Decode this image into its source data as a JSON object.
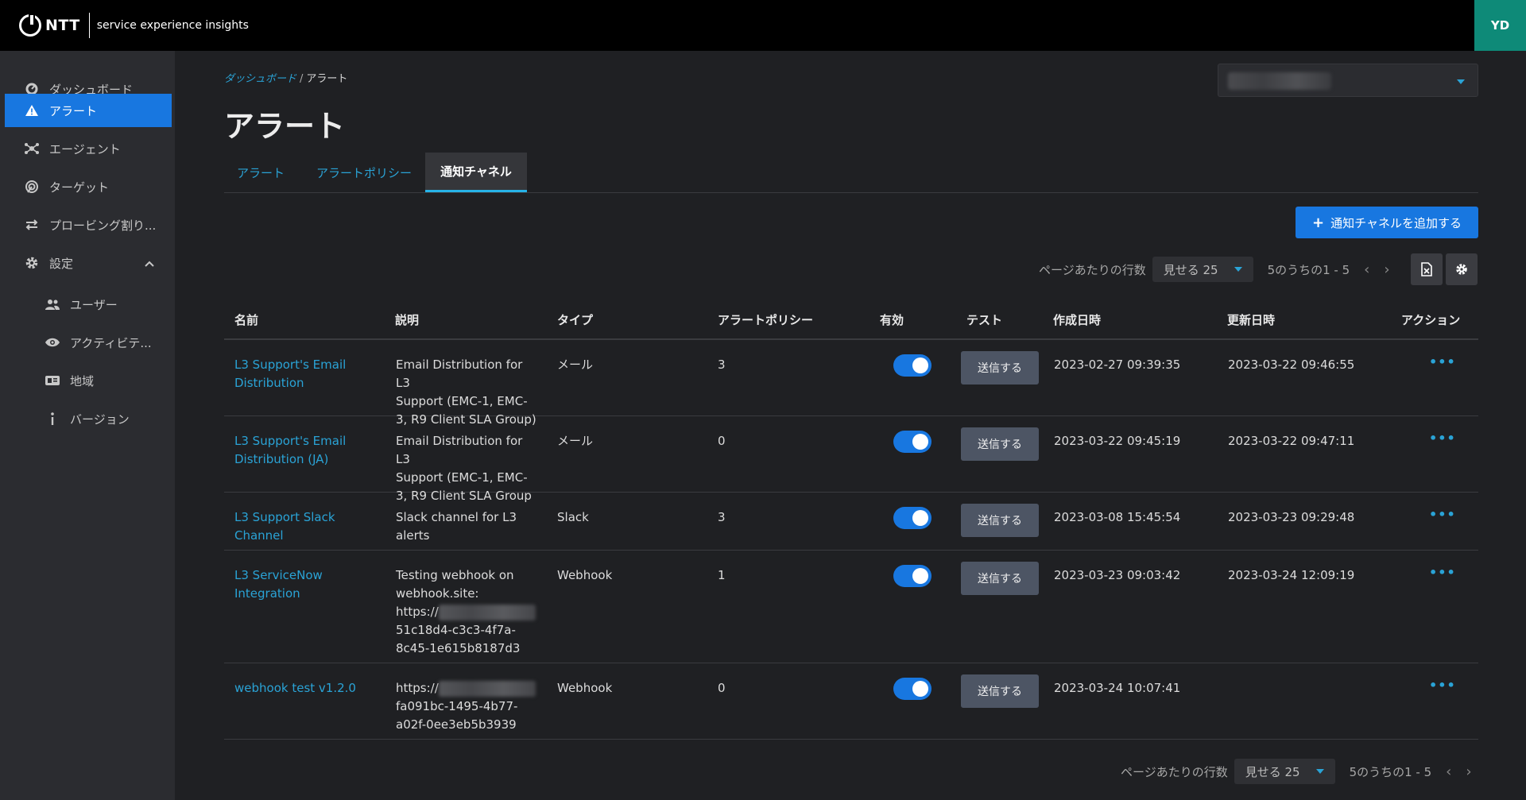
{
  "app": {
    "brand": "NTT",
    "subtitle": "service experience insights",
    "user_initials": "YD"
  },
  "sidebar": {
    "items": [
      {
        "label": "ダッシュボード",
        "icon": "dashboard-icon"
      },
      {
        "label": "アラート",
        "icon": "warning-icon",
        "active": true
      },
      {
        "label": "エージェント",
        "icon": "agent-icon"
      },
      {
        "label": "ターゲット",
        "icon": "target-icon"
      },
      {
        "label": "プロービング割り...",
        "icon": "swap-icon"
      },
      {
        "label": "設定",
        "icon": "gear-icon",
        "expanded": true
      }
    ],
    "sub_items": [
      {
        "label": "ユーザー",
        "icon": "users-icon"
      },
      {
        "label": "アクティビテ...",
        "icon": "eye-icon"
      },
      {
        "label": "地域",
        "icon": "region-card-icon"
      },
      {
        "label": "バージョン",
        "icon": "info-icon"
      }
    ]
  },
  "breadcrumb": {
    "parent": "ダッシュボード",
    "separator": "/",
    "current": "アラート"
  },
  "page_title": "アラート",
  "tabs": [
    {
      "label": "アラート"
    },
    {
      "label": "アラートポリシー"
    },
    {
      "label": "通知チャネル",
      "active": true
    }
  ],
  "add_button": {
    "label": "通知チャネルを追加する"
  },
  "pagination": {
    "rows_label": "ページあたりの行数",
    "rows_value": "見せる 25",
    "range": "5のうちの1 - 5"
  },
  "table": {
    "headers": [
      "名前",
      "説明",
      "タイプ",
      "アラートポリシー",
      "有効",
      "テスト",
      "作成日時",
      "更新日時",
      "アクション"
    ],
    "rows": [
      {
        "name": [
          "L3 Support's Email",
          "Distribution"
        ],
        "desc": [
          "Email Distribution for L3",
          "Support (EMC-1, EMC-",
          "3, R9 Client SLA Group)"
        ],
        "type": "メール",
        "policies": "3",
        "enabled": true,
        "test": "送信する",
        "created": "2023-02-27 09:39:35",
        "updated": "2023-03-22 09:46:55"
      },
      {
        "name": [
          "L3 Support's Email",
          "Distribution (JA)"
        ],
        "desc": [
          "Email Distribution for L3",
          "Support (EMC-1, EMC-",
          "3, R9 Client SLA Group"
        ],
        "type": "メール",
        "policies": "0",
        "enabled": true,
        "test": "送信する",
        "created": "2023-03-22 09:45:19",
        "updated": "2023-03-22 09:47:11"
      },
      {
        "name": [
          "L3 Support Slack",
          "Channel"
        ],
        "desc": [
          "Slack channel for L3",
          "alerts"
        ],
        "type": "Slack",
        "policies": "3",
        "enabled": true,
        "test": "送信する",
        "created": "2023-03-08 15:45:54",
        "updated": "2023-03-23 09:29:48"
      },
      {
        "name": [
          "L3 ServiceNow",
          "Integration"
        ],
        "desc": [
          "Testing webhook on",
          "webhook.site:",
          "https://",
          "51c18d4-c3c3-4f7a-",
          "8c45-1e615b8187d3"
        ],
        "type": "Webhook",
        "policies": "1",
        "enabled": true,
        "test": "送信する",
        "created": "2023-03-23 09:03:42",
        "updated": "2023-03-24 12:09:19"
      },
      {
        "name": [
          "webhook test v1.2.0"
        ],
        "desc": [
          "https://",
          "fa091bc-1495-4b77-",
          "a02f-0ee3eb5b3939"
        ],
        "type": "Webhook",
        "policies": "0",
        "enabled": true,
        "test": "送信する",
        "created": "2023-03-24 10:07:41",
        "updated": ""
      }
    ],
    "action_icon": "more-dots-icon"
  }
}
